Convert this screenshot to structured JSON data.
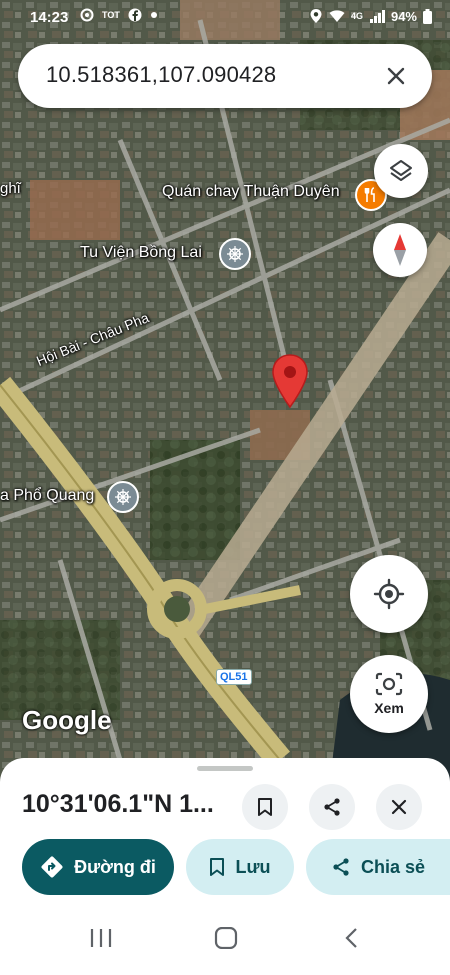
{
  "status_bar": {
    "time": "14:23",
    "notif_mid": "TOT",
    "network": "4G",
    "battery": "94%"
  },
  "search": {
    "query": "10.518361,107.090428"
  },
  "map": {
    "places": {
      "restaurant": "Quán chay Thuận Duyên",
      "temple1": "Tu Viện Bồng Lai",
      "temple2_partial": "a Phổ Quang",
      "street": "Hội Bài - Châu Pha",
      "top_left_partial": "ghĩ"
    },
    "road_badge": "QL51",
    "watermark": "Google"
  },
  "controls": {
    "lens_label": "Xem"
  },
  "sheet": {
    "coordinates": "10°31'06.1\"N 1...",
    "directions_label": "Đường đi",
    "save_label": "Lưu",
    "share_label": "Chia sẻ"
  },
  "colors": {
    "primary_teal": "#0b5a62",
    "chip_bg": "#d3eef2",
    "pin_red": "#e53935",
    "poi_orange": "#f57c00",
    "poi_gray": "#7b8b94"
  }
}
